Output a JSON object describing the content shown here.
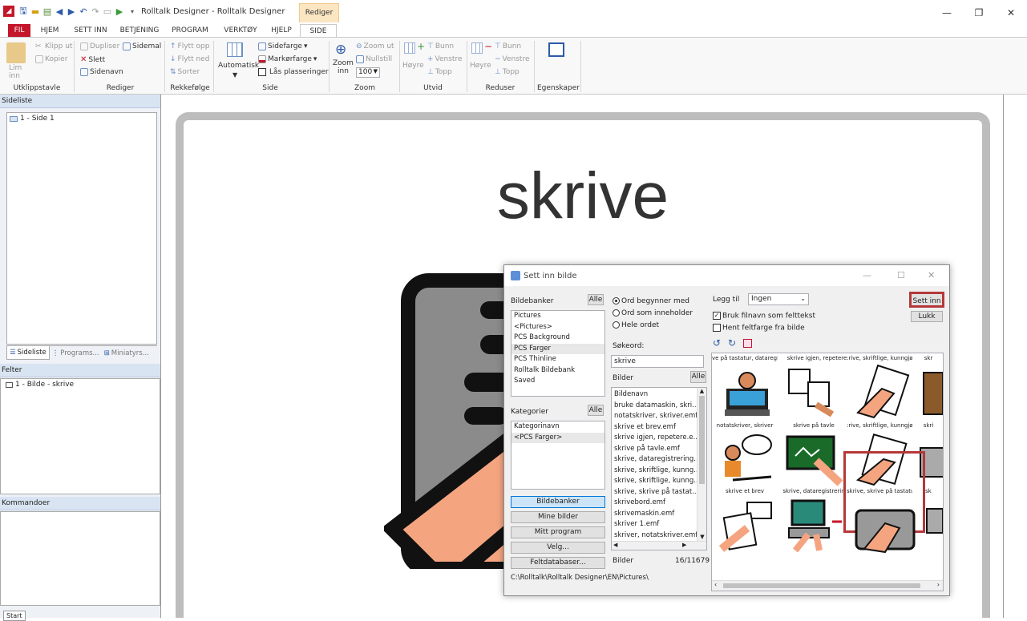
{
  "window": {
    "title": "Rolltalk Designer - Rolltalk Designer",
    "context_tab": "Rediger",
    "min": "—",
    "max": "❐",
    "close": "✕"
  },
  "tabs": [
    "FIL",
    "HJEM",
    "SETT INN",
    "BETJENING",
    "PROGRAM",
    "VERKTØY",
    "HJELP",
    "SIDE"
  ],
  "ribbon": {
    "clipboard": {
      "label": "Utklippstavle",
      "paste": "Lim inn",
      "cut": "Klipp ut",
      "copy": "Kopier"
    },
    "edit": {
      "label": "Rediger",
      "duplicate": "Dupliser",
      "template": "Sidemal",
      "delete": "Slett",
      "pagename": "Sidenavn"
    },
    "order": {
      "label": "Rekkefølge",
      "up": "Flytt opp",
      "down": "Flytt ned",
      "sort": "Sorter"
    },
    "page": {
      "label": "Side",
      "auto": "Automatisk",
      "pagecolor": "Sidefarge",
      "markcolor": "Markørfarge",
      "lock": "Lås plasseringer"
    },
    "zoom": {
      "label": "Zoom",
      "zoomin": "Zoom inn",
      "zoomout": "Zoom ut",
      "reset": "Nullstill",
      "value": "100"
    },
    "expand": {
      "label": "Utvid",
      "bottom": "Bunn",
      "right": "Høyre",
      "left": "Venstre",
      "top": "Topp"
    },
    "reduce": {
      "label": "Reduser",
      "bottom": "Bunn",
      "right": "Høyre",
      "left": "Venstre",
      "top": "Topp"
    },
    "props": {
      "label": "Egenskaper"
    }
  },
  "left": {
    "pagelist_header": "Sideliste",
    "page_item": "1 - Side 1",
    "tabs": [
      "Sideliste",
      "Programs...",
      "Miniatyrs..."
    ],
    "fields_header": "Felter",
    "field_item": "1 - Bilde - skrive",
    "commands_header": "Kommandoer",
    "start": "Start"
  },
  "canvas": {
    "word": "skrive"
  },
  "dialog": {
    "title": "Sett inn bilde",
    "min": "—",
    "max": "☐",
    "close": "✕",
    "banks_label": "Bildebanker",
    "all": "Alle",
    "banks": [
      "Pictures",
      "<Pictures>",
      "PCS Background",
      "PCS Farger",
      "PCS Thinline",
      "Rolltalk Bildebank",
      "Saved"
    ],
    "categories_label": "Kategorier",
    "categories": [
      "Kategorinavn",
      "<PCS Farger>"
    ],
    "buttons_left": [
      "Bildebanker",
      "Mine bilder",
      "Mitt program",
      "Velg...",
      "Feltdatabaser..."
    ],
    "radio": [
      "Ord begynner med",
      "Ord som inneholder",
      "Hele ordet"
    ],
    "search_label": "Søkeord:",
    "search_value": "skrive",
    "images_label": "Bilder",
    "images": [
      "Bildenavn",
      "bruke datamaskin, skri...",
      "notatskriver, skriver.emf",
      "skrive et brev.emf",
      "skrive igjen, repetere.e...",
      "skrive på tavle.emf",
      "skrive, dataregistrering...",
      "skrive, skriftlige, kunng...",
      "skrive, skriftlige, kunng...",
      "skrive, skrive på tastat...",
      "skrivebord.emf",
      "skrivemaskin.emf",
      "skriver 1.emf",
      "skriver, notatskriver.emf"
    ],
    "count_label": "Bilder",
    "count": "16/11679",
    "path": "C:\\Rolltalk\\Rolltalk Designer\\EN\\Pictures\\",
    "add_label": "Legg til",
    "add_value": "Ingen",
    "chk1": "Bruk filnavn som felttekst",
    "chk2": "Hent feltfarge fra bilde",
    "insert": "Sett inn",
    "close_btn": "Lukk",
    "captions_top": [
      "ve på tastatur, dataregist",
      "skrive igjen, repetere",
      ":rive, skriftlige, kunngjørin",
      "skr"
    ],
    "captions_r1": [
      "notatskriver, skriver",
      "skrive på tavle",
      ":rive, skriftlige, kunngjørir",
      "skri"
    ],
    "captions_r2": [
      "skrive et brev",
      "skrive, dataregistrerin",
      "skrive, skrive på tastatur",
      "sk"
    ]
  },
  "colors": {
    "highlight": "#b5383a",
    "file_tab": "#c4162a",
    "panel_header": "#d9e4f2"
  }
}
